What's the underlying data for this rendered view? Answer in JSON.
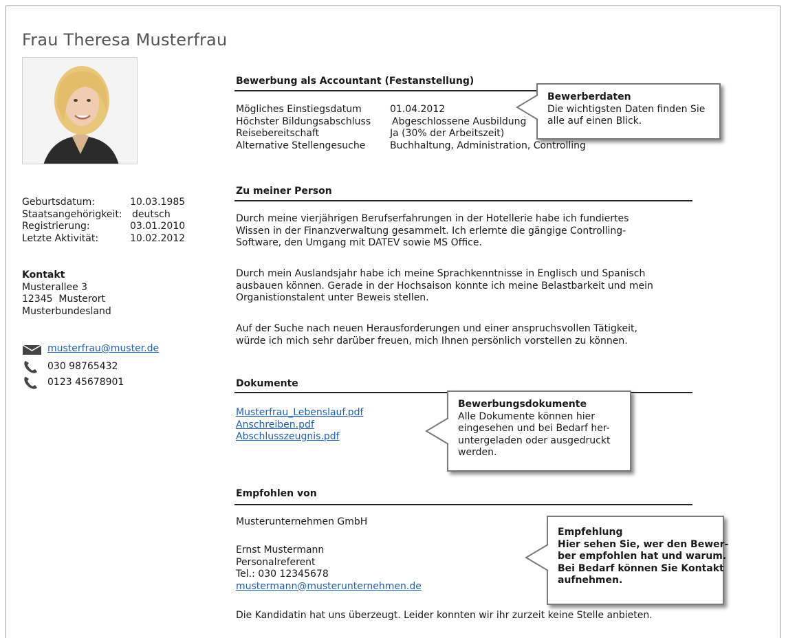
{
  "name": "Frau Theresa Musterfrau",
  "personal": [
    {
      "label": "Geburtsdatum:",
      "value": "10.03.1985"
    },
    {
      "label": "Staatsangehörigkeit:",
      "value": "deutsch"
    },
    {
      "label": "Registrierung:",
      "value": "03.01.2010"
    },
    {
      "label": "Letzte Aktivität:",
      "value": "10.02.2012"
    }
  ],
  "contact": {
    "heading": "Kontakt",
    "street": "Musterallee 3",
    "city": "12345  Musterort",
    "state": "Musterbundesland",
    "email": "musterfrau@muster.de",
    "phone1": "030 98765432",
    "phone2": "0123 45678901"
  },
  "application": {
    "heading": "Bewerbung als Accountant (Festanstellung)",
    "rows": [
      {
        "label": "Mögliches Einstiegsdatum",
        "value": "01.04.2012"
      },
      {
        "label": "Höchster Bildungsabschluss",
        "value": "Abgeschlossene Ausbildung"
      },
      {
        "label": "Reisebereitschaft",
        "value": "Ja (30% der Arbeitszeit)"
      },
      {
        "label": "Alternative Stellengesuche",
        "value": "Buchhaltung, Administration, Controlling"
      }
    ]
  },
  "about": {
    "heading": "Zu meiner Person",
    "paragraphs": [
      [
        "Durch meine vierjährigen Berufserfahrungen in der Hotellerie habe ich fundiertes",
        "Wissen in der Finanzverwaltung gesammelt. Ich erlernte die gängige Controlling-",
        "Software, den Umgang mit DATEV sowie MS Office."
      ],
      [
        "Durch mein Auslandsjahr habe ich meine Sprachkenntnisse in Englisch und Spanisch",
        "ausbauen können. Gerade in der Hochsaison konnte ich meine Belastbarkeit und mein",
        "Organistionstalent unter Beweis stellen."
      ],
      [
        "Auf der Suche nach neuen Herausforderungen und einer anspruchsvollen Tätigkeit,",
        "würde ich mich sehr darüber freuen, mich Ihnen persönlich vorstellen zu können."
      ]
    ]
  },
  "documents": {
    "heading": "Dokumente",
    "files": [
      "Musterfrau_Lebenslauf.pdf",
      "Anschreiben.pdf",
      "Abschlusszeugnis.pdf"
    ]
  },
  "recommended": {
    "heading": "Empfohlen von",
    "company": "Musterunternehmen GmbH",
    "person": "Ernst Mustermann",
    "role": "Personalreferent",
    "tel": "Tel.: 030 12345678",
    "email": "mustermann@musterunternehmen.de",
    "note": "Die Kandidatin hat uns überzeugt. Leider konnten wir ihr zurzeit keine Stelle anbieten."
  },
  "callouts": {
    "data": {
      "title": "Bewerberdaten",
      "lines": [
        "Die wichtigsten Daten finden Sie",
        "alle auf einen Blick."
      ]
    },
    "docs": {
      "title": "Bewerbungsdokumente",
      "lines": [
        "Alle Dokumente können hier",
        "eingesehen und bei Bedarf her-",
        "untergeladen oder ausgedruckt",
        "werden."
      ]
    },
    "rec": {
      "title": "Empfehlung",
      "lines": [
        "Hier sehen Sie, wer den Bewer-",
        "ber empfohlen hat und warum.",
        "Bei Bedarf können Sie Kontakt",
        "aufnehmen."
      ]
    }
  },
  "icons": {
    "email": "envelope-icon",
    "phone": "phone-icon"
  },
  "colors": {
    "link": "#1f5fb0",
    "title": "#555555",
    "callout_border": "#7a7a7a"
  }
}
